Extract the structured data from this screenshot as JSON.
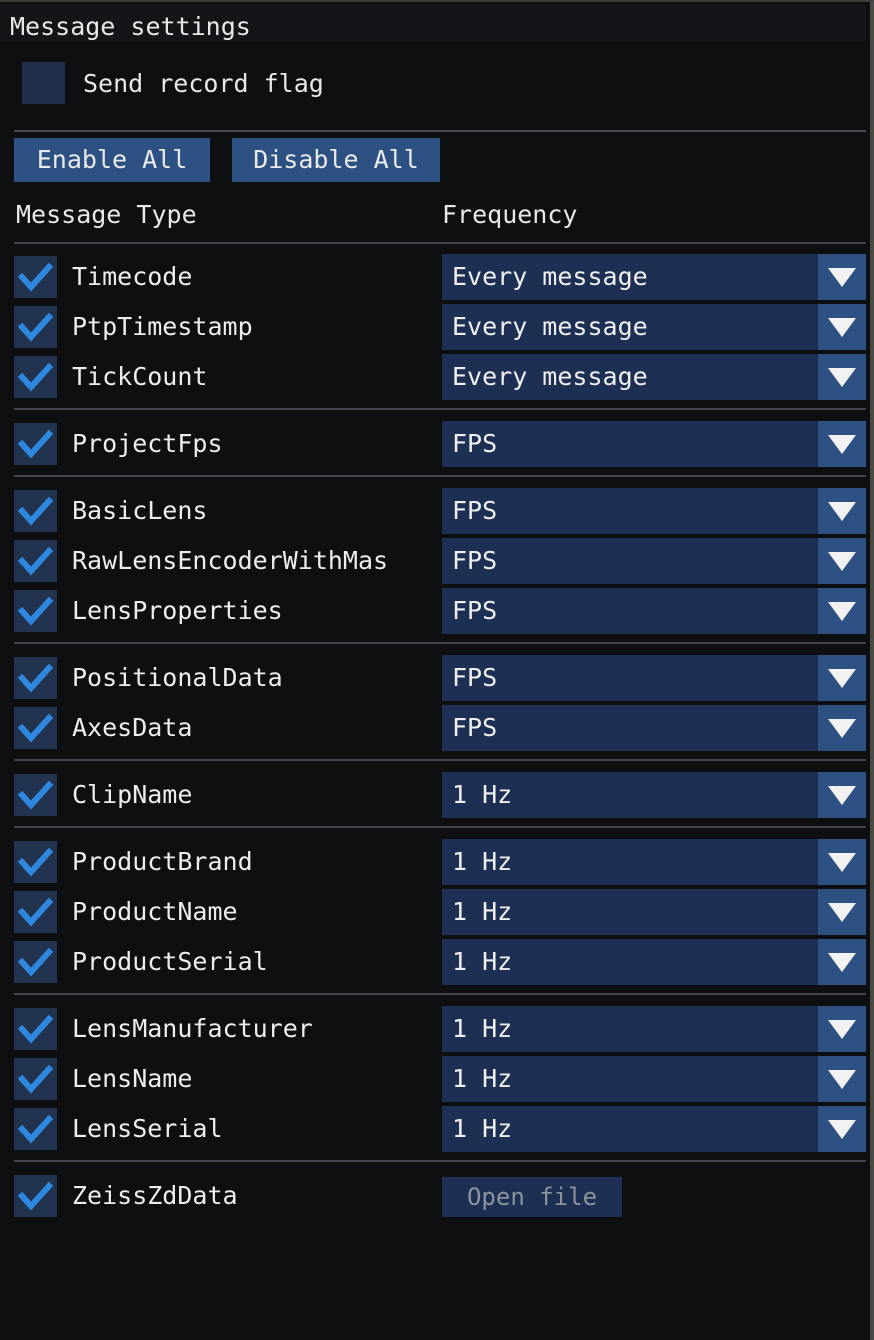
{
  "window": {
    "title": "Message settings"
  },
  "record_flag": {
    "label": "Send record flag",
    "checked": false
  },
  "actions": {
    "enable_all": "Enable All",
    "disable_all": "Disable All"
  },
  "table": {
    "headers": {
      "message_type": "Message Type",
      "frequency": "Frequency"
    },
    "rows": [
      {
        "label": "Timecode",
        "checked": true,
        "control": "combo",
        "value": "Every message",
        "group": 0
      },
      {
        "label": "PtpTimestamp",
        "checked": true,
        "control": "combo",
        "value": "Every message",
        "group": 0
      },
      {
        "label": "TickCount",
        "checked": true,
        "control": "combo",
        "value": "Every message",
        "group": 0
      },
      {
        "label": "ProjectFps",
        "checked": true,
        "control": "combo",
        "value": "FPS",
        "group": 1
      },
      {
        "label": "BasicLens",
        "checked": true,
        "control": "combo",
        "value": "FPS",
        "group": 2
      },
      {
        "label": "RawLensEncoderWithMas",
        "checked": true,
        "control": "combo",
        "value": "FPS",
        "group": 2
      },
      {
        "label": "LensProperties",
        "checked": true,
        "control": "combo",
        "value": "FPS",
        "group": 2
      },
      {
        "label": "PositionalData",
        "checked": true,
        "control": "combo",
        "value": "FPS",
        "group": 3
      },
      {
        "label": "AxesData",
        "checked": true,
        "control": "combo",
        "value": "FPS",
        "group": 3
      },
      {
        "label": "ClipName",
        "checked": true,
        "control": "combo",
        "value": "1 Hz",
        "group": 4
      },
      {
        "label": "ProductBrand",
        "checked": true,
        "control": "combo",
        "value": "1 Hz",
        "group": 5
      },
      {
        "label": "ProductName",
        "checked": true,
        "control": "combo",
        "value": "1 Hz",
        "group": 5
      },
      {
        "label": "ProductSerial",
        "checked": true,
        "control": "combo",
        "value": "1 Hz",
        "group": 5
      },
      {
        "label": "LensManufacturer",
        "checked": true,
        "control": "combo",
        "value": "1 Hz",
        "group": 6
      },
      {
        "label": "LensName",
        "checked": true,
        "control": "combo",
        "value": "1 Hz",
        "group": 6
      },
      {
        "label": "LensSerial",
        "checked": true,
        "control": "combo",
        "value": "1 Hz",
        "group": 6
      },
      {
        "label": "ZeissZdData",
        "checked": true,
        "control": "button",
        "value": "Open file",
        "group": 7
      }
    ]
  },
  "icons": {
    "checkmark": "check-icon",
    "dropdown": "chevron-down-icon"
  },
  "colors": {
    "background": "#0e0f11",
    "accent_button": "#2d5182",
    "combo_body": "#1d3053",
    "checkbox_bg": "#22334f",
    "checkmark": "#2f88e0",
    "text": "#ededed",
    "separator": "#4a4c55",
    "disabled_text": "#8b949e"
  }
}
